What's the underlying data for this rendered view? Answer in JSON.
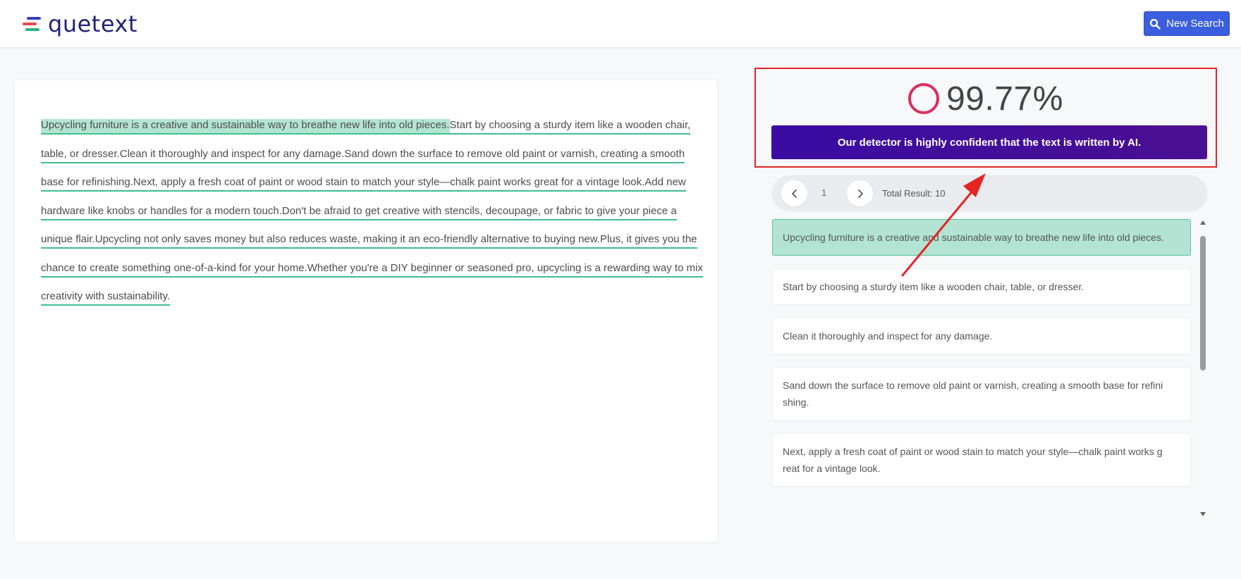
{
  "header": {
    "logo_text": "quetext",
    "new_search_label": "New Search"
  },
  "colors": {
    "brand": "#23237a",
    "accent_button": "#3b5ede",
    "highlight": "#b3e4d3",
    "underline": "#3fbf8f",
    "verdict_bg": "#3a0ca3",
    "score_ring": "#d92f5c",
    "annotation_red": "#e52424"
  },
  "document": {
    "sentences": [
      "Upcycling furniture is a creative and sustainable way to breathe new life into old pieces.",
      "Start by choosing a sturdy item like a wooden chair, table, or dresser.",
      "Clean it thoroughly and inspect for any damage.",
      "Sand down the surface to remove old paint or varnish, creating a smooth base for refinishing.",
      "Next, apply a fresh coat of paint or wood stain to match your style—chalk paint works great for a vintage look.",
      "Add new hardware like knobs or handles for a modern touch.",
      "Don't be afraid to get creative with stencils, decoupage, or fabric to give your piece a unique flair.",
      "Upcycling not only saves money but also reduces waste, making it an eco-friendly alternative to buying new.",
      "Plus, it gives you the chance to create something one-of-a-kind for your home.",
      "Whether you're a DIY beginner or seasoned pro, upcycling is a rewarding way to mix creativity with sustainability."
    ]
  },
  "score": {
    "value": "99.77%",
    "verdict": "Our detector is highly confident that the text is written by AI."
  },
  "pager": {
    "page": "1",
    "total": "Total Result: 10"
  },
  "results": [
    "Upcycling furniture is a creative and sustainable way to breathe new life into old pieces.",
    "Start by choosing a sturdy item like a wooden chair, table, or dresser.",
    "Clean it thoroughly and inspect for any damage.",
    "Sand down the surface to remove old paint or varnish, creating a smooth base for refini shing.",
    "Next, apply a fresh coat of paint or wood stain to match your style—chalk paint works g reat for a vintage look."
  ],
  "icons": {
    "search": "search-icon",
    "prev": "chevron-left-icon",
    "next": "chevron-right-icon",
    "scroll_up": "caret-up-icon",
    "scroll_down": "caret-down-icon"
  }
}
